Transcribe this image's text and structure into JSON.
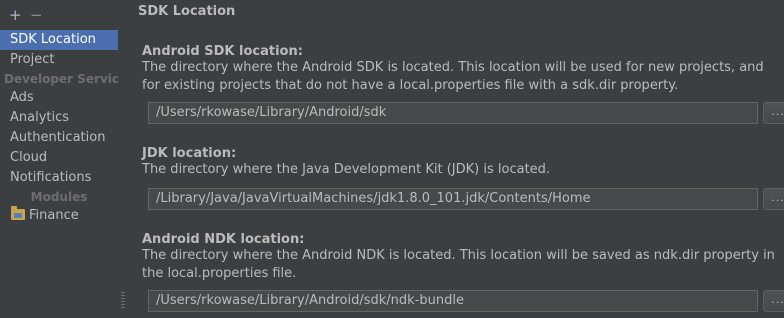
{
  "toolbar": {
    "add": "+",
    "remove": "−"
  },
  "sidebar": {
    "items": [
      {
        "label": "SDK Location"
      },
      {
        "label": "Project"
      }
    ],
    "developer_services_header": "Developer Services",
    "service_items": [
      {
        "label": "Ads"
      },
      {
        "label": "Analytics"
      },
      {
        "label": "Authentication"
      },
      {
        "label": "Cloud"
      },
      {
        "label": "Notifications"
      }
    ],
    "modules_header": "Modules",
    "modules": [
      {
        "label": "Finance",
        "icon": "folder-icon"
      }
    ]
  },
  "main": {
    "title": "SDK Location",
    "android_sdk": {
      "label": "Android SDK location:",
      "description": "The directory where the Android SDK is located. This location will be used for new projects, and for existing projects that do not have a local.properties file with a sdk.dir property.",
      "value": "/Users/rkowase/Library/Android/sdk",
      "browse": "..."
    },
    "jdk": {
      "label": "JDK location:",
      "description": "The directory where the Java Development Kit (JDK) is located.",
      "value": "/Library/Java/JavaVirtualMachines/jdk1.8.0_101.jdk/Contents/Home",
      "browse": "..."
    },
    "android_ndk": {
      "label": "Android NDK location:",
      "description": "The directory where the Android NDK is located. This location will be saved as ndk.dir property in the local.properties file.",
      "value": "/Users/rkowase/Library/Android/sdk/ndk-bundle",
      "browse": "..."
    }
  },
  "colors": {
    "background": "#3c3f41",
    "selection": "#4b6eaf",
    "field": "#45494a"
  }
}
